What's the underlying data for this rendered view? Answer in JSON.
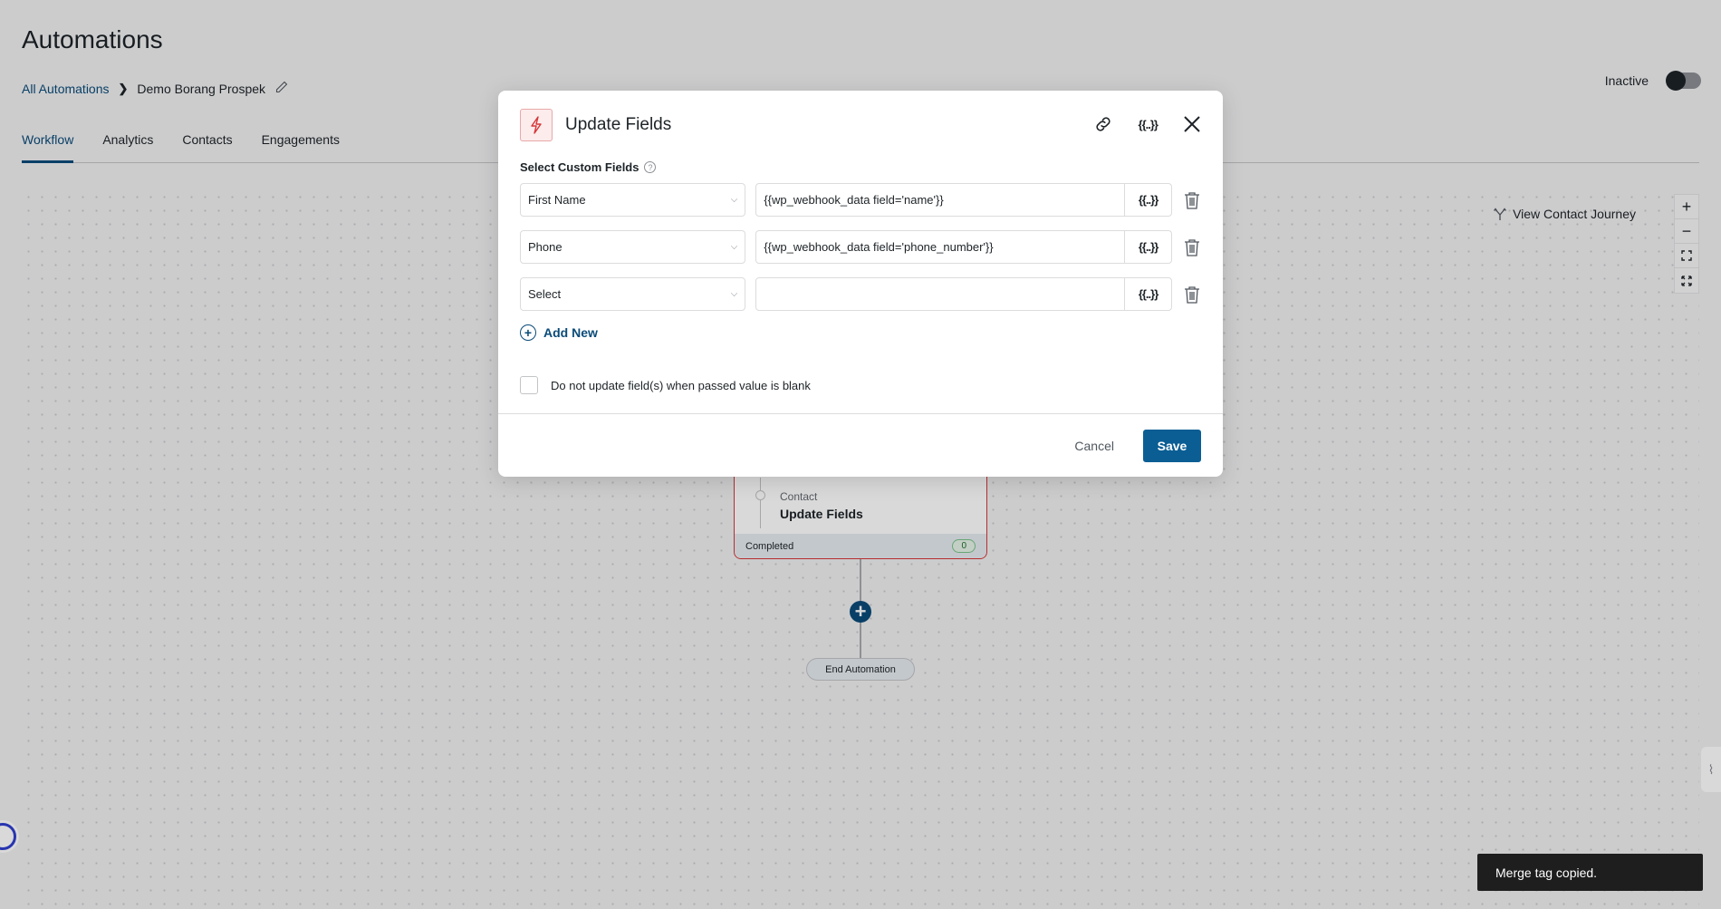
{
  "page": {
    "title": "Automations",
    "breadcrumb": {
      "root": "All Automations",
      "current": "Demo Borang Prospek"
    },
    "tabs": [
      "Workflow",
      "Analytics",
      "Contacts",
      "Engagements"
    ],
    "active_tab": "Workflow",
    "status_label": "Inactive",
    "status_active": false
  },
  "canvas": {
    "journey_label": "View Contact Journey",
    "zoom_controls": [
      "zoom-in",
      "zoom-out",
      "fit",
      "fullscreen"
    ],
    "node": {
      "category": "Contact",
      "name": "Update Fields",
      "footer_label": "Completed",
      "count": "0"
    },
    "end_label": "End Automation"
  },
  "modal": {
    "title": "Update Fields",
    "section_label": "Select Custom Fields",
    "rows": [
      {
        "field": "First Name",
        "value": "{{wp_webhook_data field='name'}}"
      },
      {
        "field": "Phone",
        "value": "{{wp_webhook_data field='phone_number'}}"
      },
      {
        "field": "Select",
        "value": ""
      }
    ],
    "merge_tag_label": "{{..}}",
    "add_new_label": "Add New",
    "checkbox_label": "Do not update field(s) when passed value is blank",
    "checkbox_checked": false,
    "cancel_label": "Cancel",
    "save_label": "Save"
  },
  "toast": {
    "message": "Merge tag copied."
  },
  "colors": {
    "accent": "#0a4b78",
    "save": "#0a5e94",
    "danger": "#d63638"
  }
}
